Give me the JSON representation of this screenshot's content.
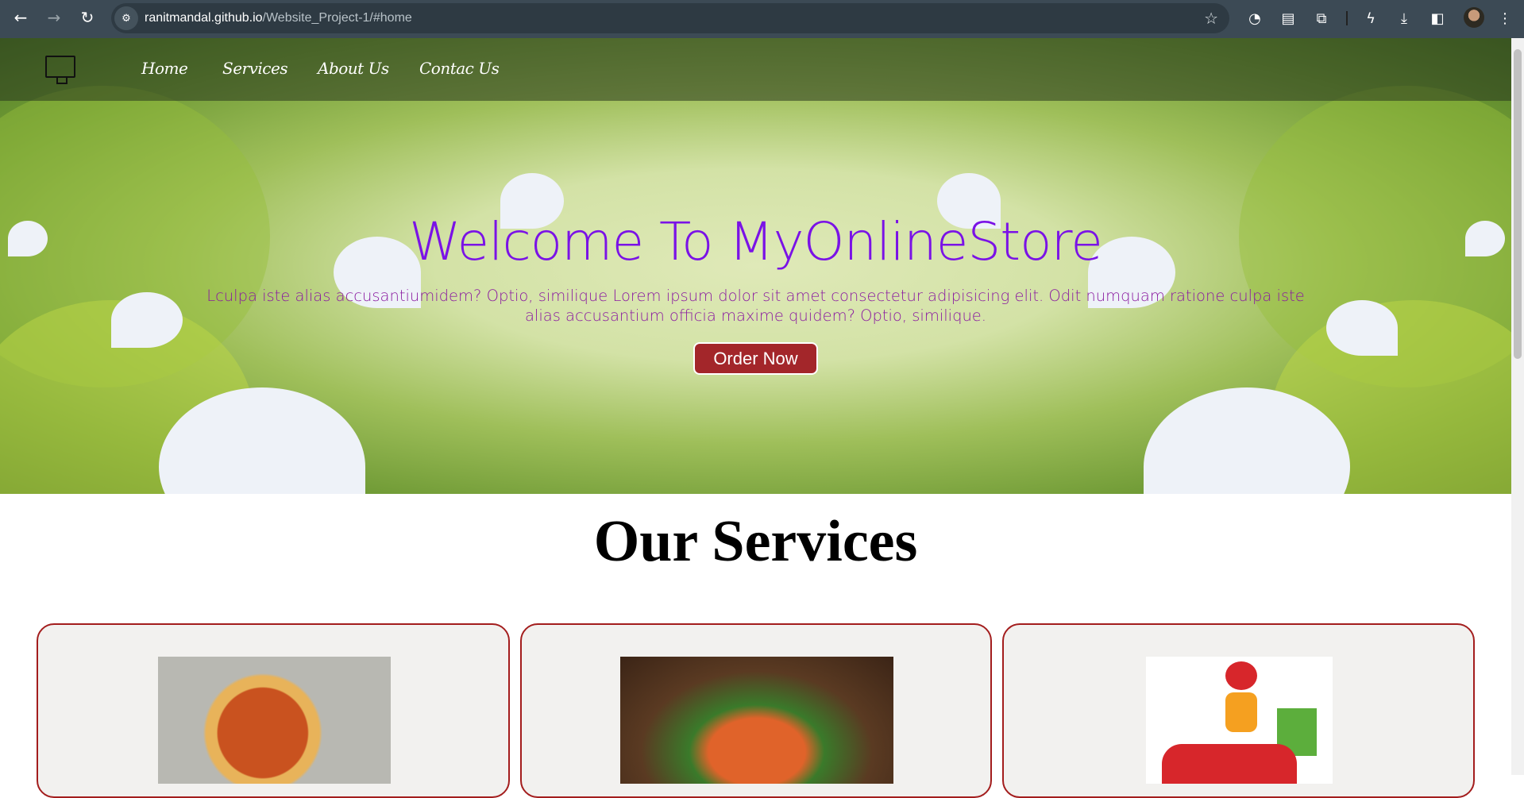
{
  "browser": {
    "url_host": "ranitmandal.github.io",
    "url_path": "/Website_Project-1/#home",
    "icons": [
      "back-icon",
      "forward-icon",
      "reload-icon",
      "site-settings-icon",
      "bookmark-star-icon",
      "speed-icon",
      "tab-search-icon",
      "extensions-icon",
      "energy-icon",
      "download-icon",
      "side-panel-icon",
      "profile-avatar",
      "menu-icon"
    ]
  },
  "nav": {
    "items": [
      {
        "label": "Home"
      },
      {
        "label": "Services"
      },
      {
        "label": "About Us"
      },
      {
        "label": "Contac Us"
      }
    ]
  },
  "hero": {
    "title": "Welcome To MyOnlineStore",
    "paragraph": "Lculpa iste alias accusantiumidem? Optio, similique Lorem ipsum dolor sit amet consectetur adipisicing elit. Odit numquam ratione culpa iste alias accusantium officia maxime quidem? Optio, similique.",
    "button": "Order Now"
  },
  "services": {
    "heading": "Our Services"
  },
  "colors": {
    "accent": "#a3262a",
    "title": "#7a12e6",
    "paragraph": "#8a1aa0",
    "card_border": "#a31d1d"
  }
}
